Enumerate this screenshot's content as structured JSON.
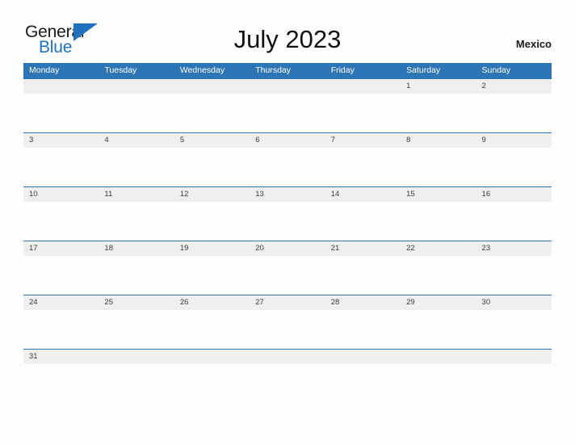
{
  "header": {
    "logo": {
      "word_one": "General",
      "word_two": "Blue",
      "mark": "blue-triangle-flag-icon"
    },
    "title": "July 2023",
    "region": "Mexico"
  },
  "colors": {
    "header_blue": "#2E75B6",
    "row_rule_blue": "#2E75B6",
    "day_band_gray": "#EFEFEF",
    "logo_blue": "#1F72BD",
    "page_background": "#FEFEFE"
  },
  "calendar": {
    "month": "July",
    "year": "2023",
    "week_start": "Monday",
    "weekdays": [
      "Monday",
      "Tuesday",
      "Wednesday",
      "Thursday",
      "Friday",
      "Saturday",
      "Sunday"
    ],
    "weeks": [
      [
        "",
        "",
        "",
        "",
        "",
        "1",
        "2"
      ],
      [
        "3",
        "4",
        "5",
        "6",
        "7",
        "8",
        "9"
      ],
      [
        "10",
        "11",
        "12",
        "13",
        "14",
        "15",
        "16"
      ],
      [
        "17",
        "18",
        "19",
        "20",
        "21",
        "22",
        "23"
      ],
      [
        "24",
        "25",
        "26",
        "27",
        "28",
        "29",
        "30"
      ],
      [
        "31",
        "",
        "",
        "",
        "",
        "",
        ""
      ]
    ]
  }
}
